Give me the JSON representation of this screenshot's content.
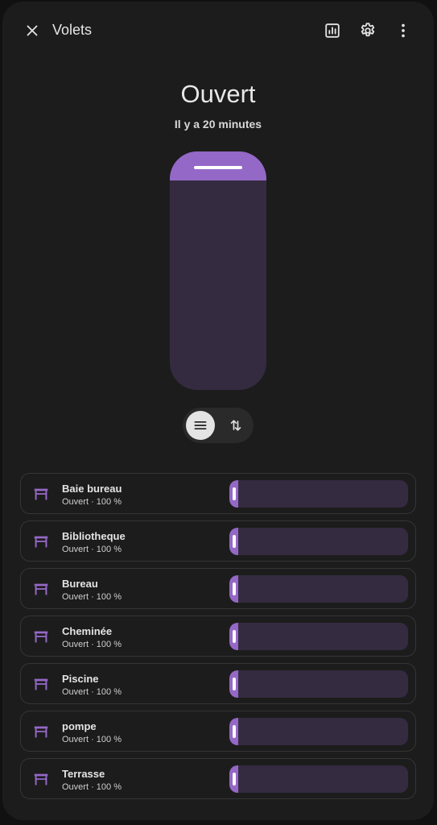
{
  "header": {
    "title": "Volets",
    "close_icon": "close-icon",
    "history_icon": "chart-box-icon",
    "settings_icon": "gear-icon",
    "more_icon": "dots-vertical-icon"
  },
  "state": {
    "label": "Ouvert",
    "last_changed": "Il y a 20 minutes",
    "position_closed_fraction": 0.12
  },
  "mode_toggle": {
    "position_icon": "menu-lines-icon",
    "buttons_icon": "swap-vertical-icon",
    "selected": "position"
  },
  "colors": {
    "accent": "#9468c6",
    "slider_track": "#342b40",
    "background": "#1c1c1c"
  },
  "covers": [
    {
      "name": "Baie bureau",
      "status": "Ouvert · 100 %",
      "icon": "shutter-icon",
      "level": 0.05
    },
    {
      "name": "Bibliotheque",
      "status": "Ouvert · 100 %",
      "icon": "shutter-icon",
      "level": 0.05
    },
    {
      "name": "Bureau",
      "status": "Ouvert · 100 %",
      "icon": "shutter-icon",
      "level": 0.05
    },
    {
      "name": "Cheminée",
      "status": "Ouvert · 100 %",
      "icon": "shutter-icon",
      "level": 0.05
    },
    {
      "name": "Piscine",
      "status": "Ouvert · 100 %",
      "icon": "shutter-icon",
      "level": 0.05
    },
    {
      "name": "pompe",
      "status": "Ouvert · 100 %",
      "icon": "shutter-icon",
      "level": 0.05
    },
    {
      "name": "Terrasse",
      "status": "Ouvert · 100 %",
      "icon": "shutter-icon",
      "level": 0.05
    }
  ]
}
